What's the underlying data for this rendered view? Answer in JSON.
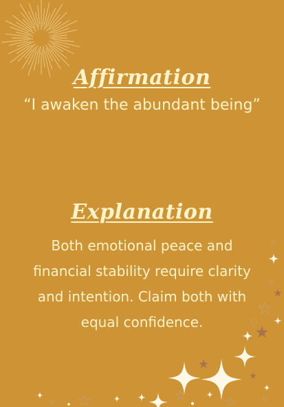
{
  "affirmation": {
    "title": "Affirmation",
    "text": "“I awaken the abundant being”"
  },
  "explanation": {
    "title": "Explanation",
    "text": "Both emotional peace and financial stability require clarity and intention. Claim both with equal confidence."
  },
  "colors": {
    "background": "#cd9335",
    "text": "#fff3c9",
    "star_dark": "#a8724a",
    "star_light": "#fff8e6"
  },
  "decorations": {
    "top_left": "sunburst-lines",
    "bottom_right": "sparkle-stars"
  }
}
